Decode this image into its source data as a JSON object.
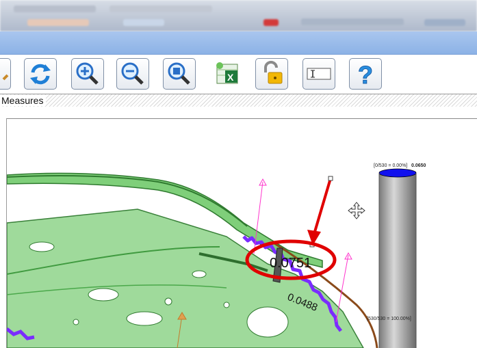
{
  "toolbar": {
    "buttons": [
      {
        "name": "refresh",
        "icon": "refresh-icon"
      },
      {
        "name": "zoom-in",
        "icon": "zoom-in-icon"
      },
      {
        "name": "zoom-out",
        "icon": "zoom-out-icon"
      },
      {
        "name": "zoom-fit",
        "icon": "zoom-fit-icon"
      },
      {
        "name": "export-excel",
        "icon": "excel-export-icon"
      },
      {
        "name": "unlock",
        "icon": "padlock-open-icon"
      },
      {
        "name": "text-box",
        "icon": "text-field-icon"
      },
      {
        "name": "help",
        "icon": "question-mark-icon"
      }
    ]
  },
  "panel": {
    "title": "Measures"
  },
  "viewport": {
    "measurement_primary": "0.0751",
    "measurement_secondary": "0.0488",
    "scale_top_label": "[0/530 = 0.00%]",
    "scale_top_value": "0.0650",
    "scale_bottom_label": "[530/530 = 100.00%]",
    "colors": {
      "part_green": "#7fcf7a",
      "part_dark": "#2f7a2f",
      "seam_purple": "#7a2cff",
      "callout_red": "#e00000",
      "vector_magenta": "#ff33cc",
      "scale_top": "#1111ee",
      "scale_bar": "#9a9a9a"
    }
  }
}
